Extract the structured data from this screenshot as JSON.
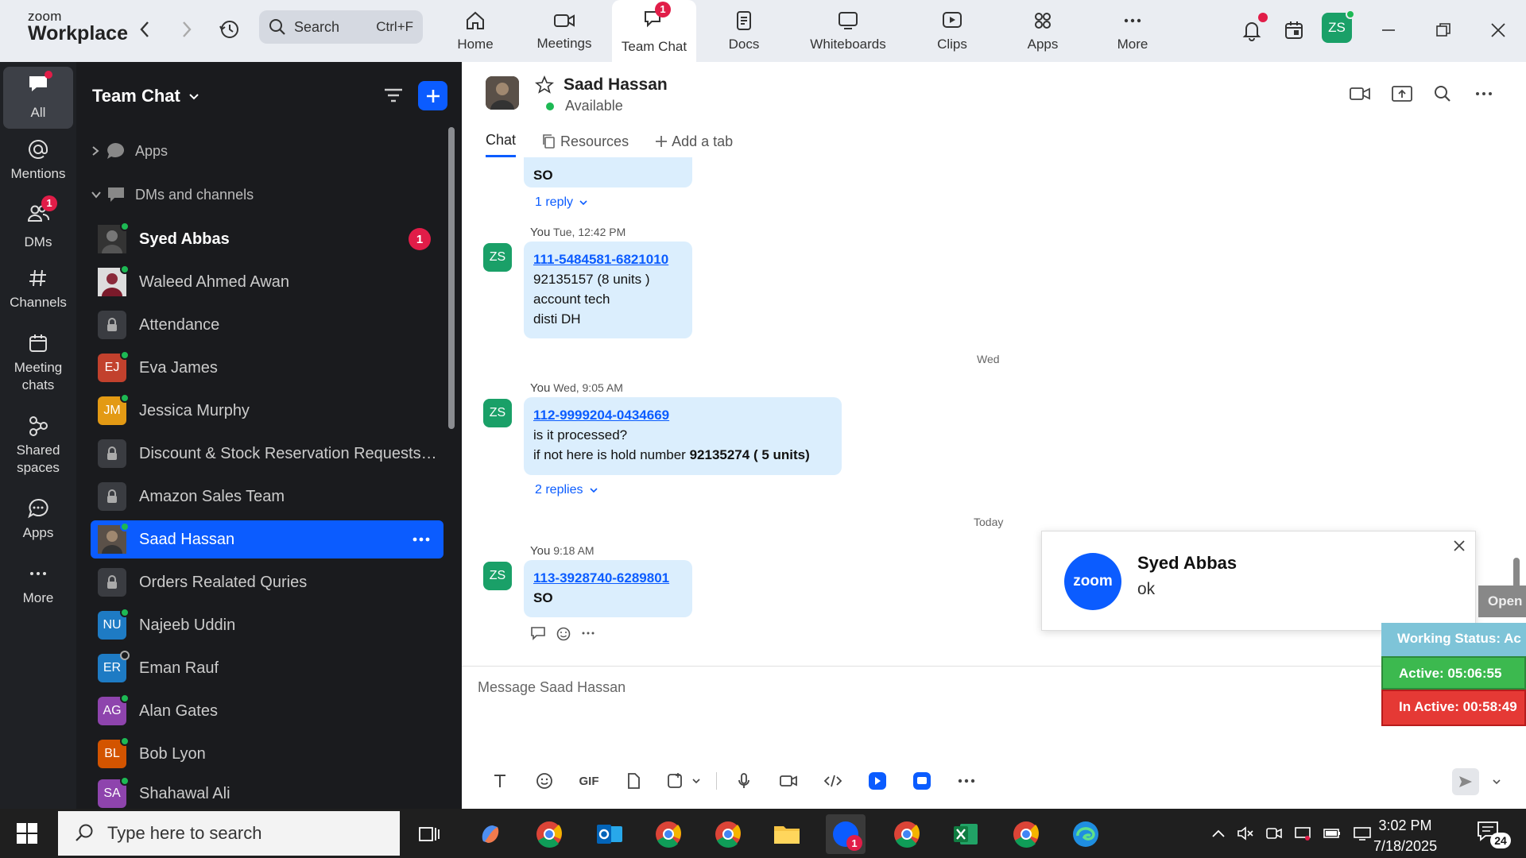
{
  "app": {
    "brand_top": "zoom",
    "brand_bottom": "Workplace"
  },
  "search": {
    "label": "Search",
    "shortcut": "Ctrl+F"
  },
  "topnav": [
    {
      "label": "Home",
      "icon": "home-icon"
    },
    {
      "label": "Meetings",
      "icon": "video-camera-icon"
    },
    {
      "label": "Team Chat",
      "icon": "chat-bubble-icon",
      "badge": "1",
      "active": true
    },
    {
      "label": "Docs",
      "icon": "document-icon"
    },
    {
      "label": "Whiteboards",
      "icon": "whiteboard-icon"
    },
    {
      "label": "Clips",
      "icon": "clips-icon"
    },
    {
      "label": "Apps",
      "icon": "apps-grid-icon"
    },
    {
      "label": "More",
      "icon": "more-dots-icon"
    }
  ],
  "user": {
    "initials": "ZS"
  },
  "rail": [
    {
      "label": "All",
      "icon": "chat-icon",
      "active": true
    },
    {
      "label": "Mentions",
      "icon": "at-icon"
    },
    {
      "label": "DMs",
      "icon": "people-icon",
      "badge": "1"
    },
    {
      "label": "Channels",
      "icon": "hash-icon"
    },
    {
      "label": "Meeting chats",
      "icon": "calendar-icon"
    },
    {
      "label": "Shared spaces",
      "icon": "shared-spaces-icon"
    },
    {
      "label": "Apps",
      "icon": "apps-chat-icon"
    },
    {
      "label": "More",
      "icon": "more-icon"
    }
  ],
  "sidebar": {
    "title": "Team Chat",
    "section_apps": "Apps",
    "section_dms": "DMs and channels",
    "items": [
      {
        "name": "Syed Abbas",
        "badge": "1",
        "bold": true
      },
      {
        "name": "Waleed Ahmed Awan"
      },
      {
        "name": "Attendance",
        "locked": true
      },
      {
        "name": "Eva James",
        "initials": "EJ"
      },
      {
        "name": "Jessica Murphy",
        "initials": "JM"
      },
      {
        "name": "Discount & Stock Reservation Requests O...",
        "locked": true
      },
      {
        "name": "Amazon Sales Team",
        "locked": true
      },
      {
        "name": "Saad Hassan",
        "selected": true
      },
      {
        "name": "Orders Realated Quries",
        "locked": true
      },
      {
        "name": "Najeeb Uddin",
        "initials": "NU"
      },
      {
        "name": "Eman Rauf",
        "initials": "ER"
      },
      {
        "name": "Alan Gates",
        "initials": "AG"
      },
      {
        "name": "Bob Lyon",
        "initials": "BL"
      },
      {
        "name": "Shahawal Ali",
        "initials": "SA"
      }
    ]
  },
  "chat": {
    "name": "Saad Hassan",
    "status": "Available",
    "tabs": [
      "Chat",
      "Resources",
      "Add a tab"
    ],
    "messages": [
      {
        "partial_text": "SO",
        "replies": "1 reply"
      },
      {
        "sender": "You",
        "time": "Tue, 12:42 PM",
        "link": "111-5484581-6821010",
        "lines": [
          "92135157 (8 units )",
          "account tech",
          "disti DH"
        ]
      },
      {
        "date_sep": "Wed"
      },
      {
        "sender": "You",
        "time": "Wed, 9:05 AM",
        "link": "112-9999204-0434669",
        "lines": [
          "is it processed?"
        ],
        "hold_prefix": "if not here is hold number",
        "hold_bold": "92135274 ( 5 units)",
        "replies": "2 replies"
      },
      {
        "date_sep": "Today"
      },
      {
        "sender": "You",
        "time": "9:18 AM",
        "link": "113-3928740-6289801",
        "bold_line": "SO"
      }
    ],
    "composer_placeholder": "Message Saad Hassan",
    "toolbar_gif": "GIF"
  },
  "notification": {
    "logo": "zoom",
    "title": "Syed Abbas",
    "body": "ok"
  },
  "overlay": {
    "open": "Open",
    "working": "Working Status: Ac",
    "active": "Active: 05:06:55",
    "inactive": "In Active: 00:58:49"
  },
  "taskbar": {
    "search_placeholder": "Type here to search",
    "time": "3:02 PM",
    "date": "7/18/2025",
    "notif_count": "24",
    "zoom_badge": "1"
  },
  "colors": {
    "accent": "#0b5cff",
    "badge": "#e11d48",
    "online": "#1db954",
    "bubble": "#dbeefd"
  }
}
